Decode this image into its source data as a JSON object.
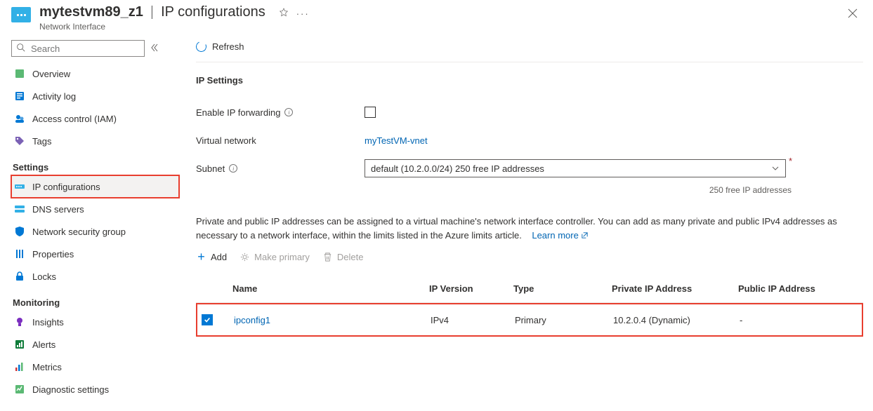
{
  "header": {
    "resource_name": "mytestvm89_z1",
    "page_title": "IP configurations",
    "subtitle": "Network Interface"
  },
  "sidebar": {
    "search_placeholder": "Search",
    "top_items": [
      {
        "label": "Overview",
        "icon": "overview"
      },
      {
        "label": "Activity log",
        "icon": "activitylog"
      },
      {
        "label": "Access control (IAM)",
        "icon": "iam"
      },
      {
        "label": "Tags",
        "icon": "tags"
      }
    ],
    "groups": [
      {
        "title": "Settings",
        "items": [
          {
            "label": "IP configurations",
            "icon": "ipconfig",
            "selected": true,
            "highlight": true
          },
          {
            "label": "DNS servers",
            "icon": "dns"
          },
          {
            "label": "Network security group",
            "icon": "nsg"
          },
          {
            "label": "Properties",
            "icon": "properties"
          },
          {
            "label": "Locks",
            "icon": "locks"
          }
        ]
      },
      {
        "title": "Monitoring",
        "items": [
          {
            "label": "Insights",
            "icon": "insights"
          },
          {
            "label": "Alerts",
            "icon": "alerts"
          },
          {
            "label": "Metrics",
            "icon": "metrics"
          },
          {
            "label": "Diagnostic settings",
            "icon": "diag"
          }
        ]
      }
    ]
  },
  "toolbar": {
    "refresh": "Refresh"
  },
  "ipsettings": {
    "section_title": "IP Settings",
    "forwarding_label": "Enable IP forwarding",
    "forwarding_enabled": false,
    "vnet_label": "Virtual network",
    "vnet_value": "myTestVM-vnet",
    "subnet_label": "Subnet",
    "subnet_value": "default (10.2.0.0/24) 250 free IP addresses",
    "subnet_hint": "250 free IP addresses"
  },
  "description": "Private and public IP addresses can be assigned to a virtual machine's network interface controller. You can add as many private and public IPv4 addresses as necessary to a network interface, within the limits listed in the Azure limits article.",
  "learn_more": "Learn more",
  "actions": {
    "add": "Add",
    "make_primary": "Make primary",
    "delete": "Delete"
  },
  "table": {
    "columns": [
      "Name",
      "IP Version",
      "Type",
      "Private IP Address",
      "Public IP Address"
    ],
    "rows": [
      {
        "checked": true,
        "name": "ipconfig1",
        "ip_version": "IPv4",
        "type": "Primary",
        "private": "10.2.0.4 (Dynamic)",
        "public": "-"
      }
    ]
  }
}
